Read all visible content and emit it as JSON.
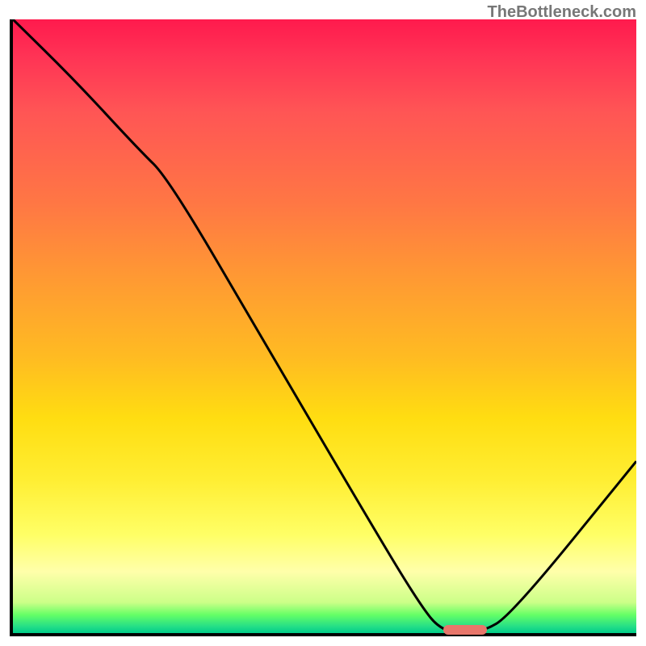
{
  "watermark": "TheBottleneck.com",
  "chart_data": {
    "type": "line",
    "title": "",
    "xlabel": "",
    "ylabel": "",
    "xlim": [
      0,
      100
    ],
    "ylim": [
      0,
      100
    ],
    "series": [
      {
        "name": "curve",
        "x": [
          0,
          10,
          20,
          25,
          40,
          55,
          65,
          69,
          75,
          80,
          100
        ],
        "y": [
          100,
          90,
          79,
          74,
          48,
          22,
          5,
          0,
          0,
          3,
          28
        ]
      }
    ],
    "marker": {
      "x_start": 69,
      "x_end": 76,
      "y": 0.5,
      "color": "#e8766b"
    },
    "background_gradient": {
      "stops": [
        {
          "pos": 0,
          "color": "#ff1a4d"
        },
        {
          "pos": 15,
          "color": "#ff5555"
        },
        {
          "pos": 42,
          "color": "#ff9933"
        },
        {
          "pos": 65,
          "color": "#ffdd11"
        },
        {
          "pos": 84,
          "color": "#ffff66"
        },
        {
          "pos": 95,
          "color": "#ccff88"
        },
        {
          "pos": 100,
          "color": "#00cc88"
        }
      ]
    }
  }
}
